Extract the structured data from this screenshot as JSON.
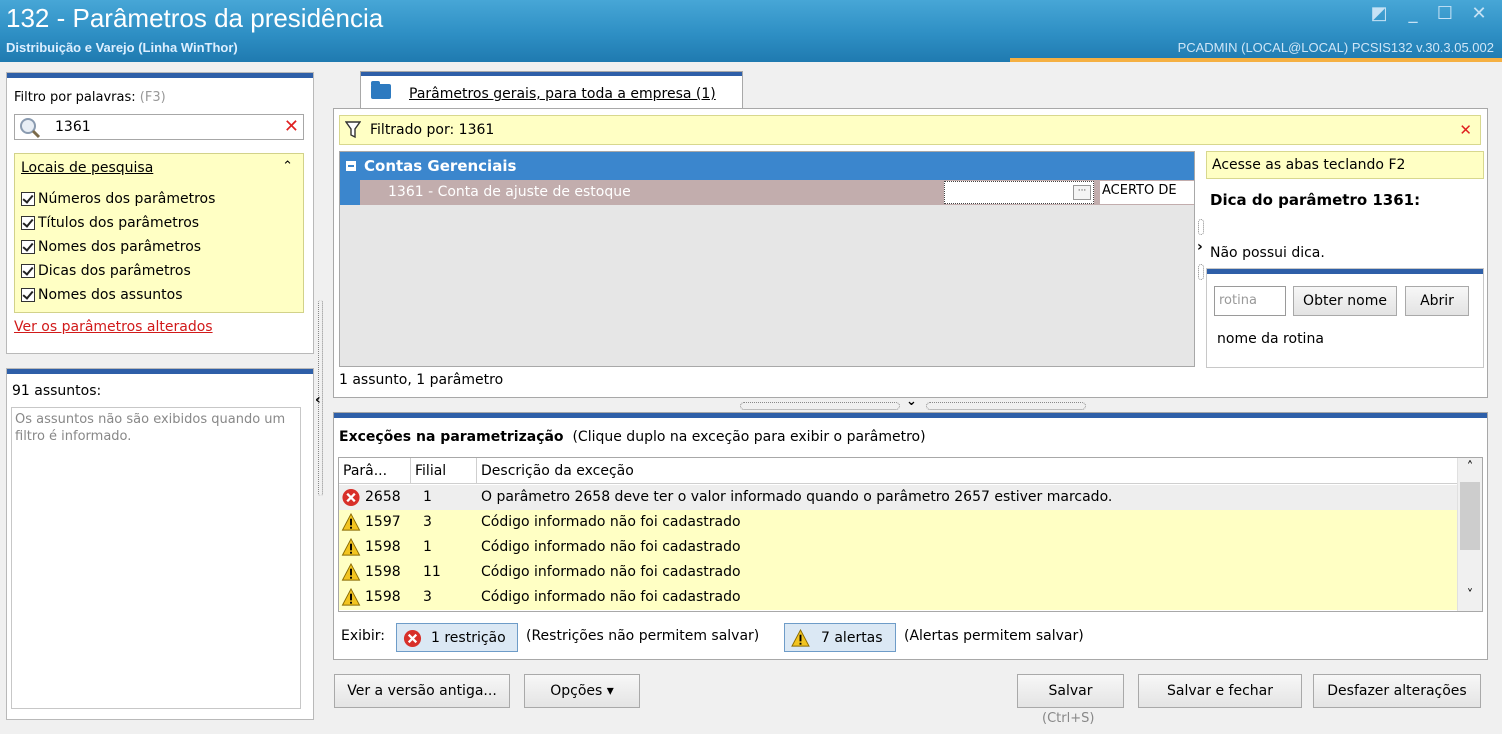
{
  "window": {
    "title": "132 - Parâmetros da presidência",
    "subtitle": "Distribuição e Varejo (Linha WinThor)",
    "user_info": "PCADMIN (LOCAL@LOCAL)   PCSIS132  v.30.3.05.002",
    "controls": {
      "restore": "◩",
      "minimize": "_",
      "maximize": "☐",
      "close": "✕"
    }
  },
  "filter": {
    "label": "Filtro por palavras:",
    "shortcut_hint": "(F3)",
    "search_value": "1361",
    "clear_glyph": "✕",
    "locais": {
      "title": "Locais de pesquisa",
      "collapse_glyph": "⌃",
      "options": [
        "Números dos parâmetros",
        "Títulos dos parâmetros",
        "Nomes dos parâmetros",
        "Dicas dos parâmetros",
        "Nomes dos assuntos"
      ]
    },
    "changed_link": "Ver os parâmetros alterados"
  },
  "assuntos": {
    "header": "91 assuntos:",
    "message": "Os assuntos não são exibidos quando um filtro é informado."
  },
  "tab": {
    "label": "Parâmetros gerais, para toda a empresa  (1)"
  },
  "filtered": {
    "text": "Filtrado por: 1361",
    "clear_glyph": "✕"
  },
  "grid": {
    "group": "Contas Gerenciais",
    "param_label": "1361 - Conta de ajuste de estoque",
    "ellipsis": "···",
    "param_value": "ACERTO DE",
    "count": "1 assunto, 1 parâmetro"
  },
  "hint": {
    "access_tip": "Acesse as abas teclando F2",
    "title": "Dica do parâmetro 1361:",
    "text": "Não possui dica."
  },
  "rotina": {
    "placeholder": "rotina",
    "get_name_button": "Obter nome",
    "open_button": "Abrir",
    "name_label": "nome da rotina"
  },
  "splitters": {
    "left_arrow": "‹",
    "down_arrow": "⌄",
    "side_arrow": "›"
  },
  "exceptions": {
    "title": "Exceções na parametrização",
    "subtitle": "(Clique duplo na exceção para exibir o parâmetro)",
    "columns": [
      "Parâ...",
      "Filial",
      "Descrição da exceção"
    ],
    "rows": [
      {
        "type": "error",
        "param": "2658",
        "filial": "1",
        "desc": "O parâmetro 2658 deve ter o valor informado quando o parâmetro 2657 estiver marcado."
      },
      {
        "type": "warning",
        "param": "1597",
        "filial": "3",
        "desc": "Código informado não foi cadastrado"
      },
      {
        "type": "warning",
        "param": "1598",
        "filial": "1",
        "desc": "Código informado não foi cadastrado"
      },
      {
        "type": "warning",
        "param": "1598",
        "filial": "11",
        "desc": "Código informado não foi cadastrado"
      },
      {
        "type": "warning",
        "param": "1598",
        "filial": "3",
        "desc": "Código informado não foi cadastrado"
      }
    ],
    "show_label": "Exibir:",
    "restriction_button": "1 restrição",
    "restriction_note": "(Restrições não permitem salvar)",
    "alert_button": "7 alertas",
    "alert_note": "(Alertas permitem salvar)",
    "scroll_up": "˄",
    "scroll_down": "˅"
  },
  "footer": {
    "old_version": "Ver a versão antiga...",
    "options": "Opções ▾",
    "save": "Salvar",
    "save_shortcut": "(Ctrl+S)",
    "save_close": "Salvar e fechar",
    "undo": "Desfazer alterações"
  },
  "colors": {
    "title_blue": "#2e8fc4",
    "accent_blue": "#2e5fa8",
    "group_blue": "#3b86cd",
    "highlight_yellow": "#ffffc4",
    "error_red": "#e02020"
  }
}
